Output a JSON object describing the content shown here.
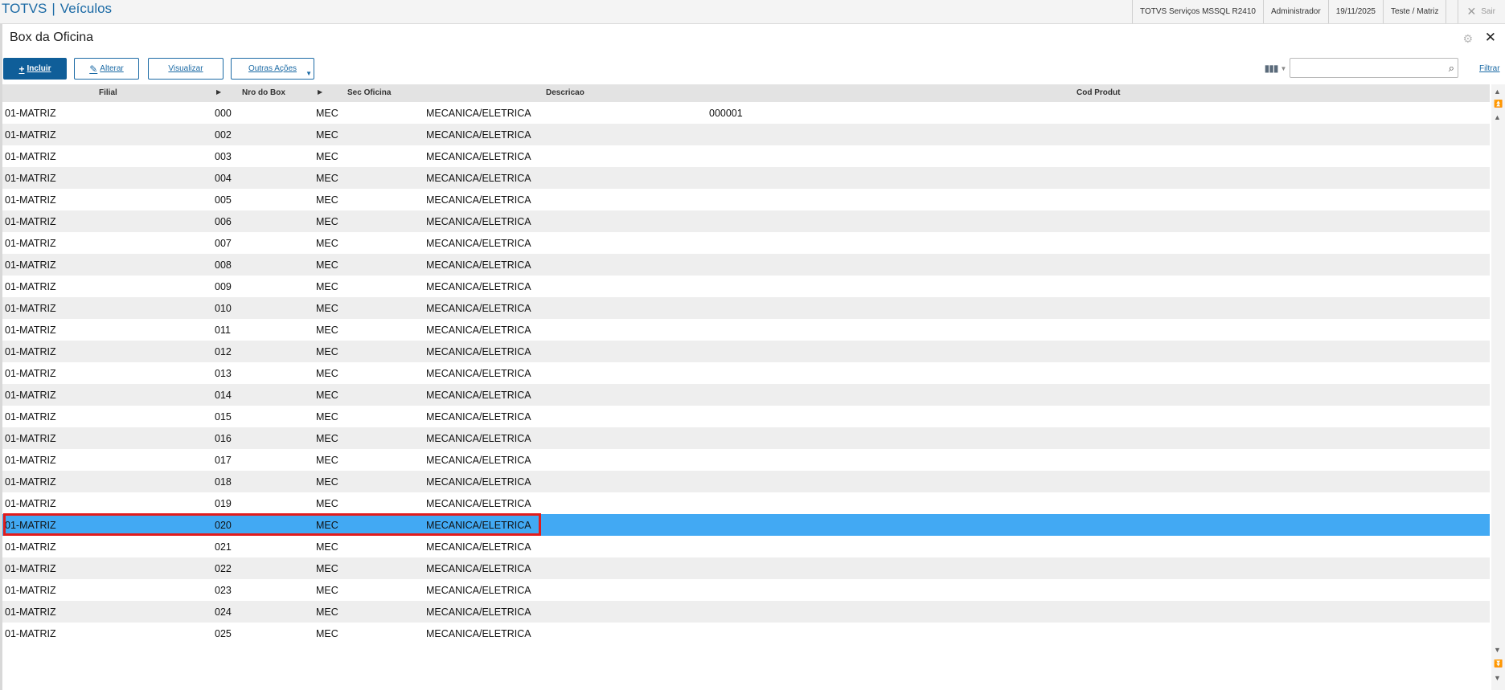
{
  "topbar": {
    "brand": "TOTVS",
    "module": "Veículos",
    "environment": "TOTVS Serviços MSSQL R2410",
    "user": "Administrador",
    "date": "19/11/2025",
    "company": "Teste / Matriz",
    "logout_label": "Sair"
  },
  "page": {
    "title": "Box da Oficina"
  },
  "toolbar": {
    "incluir": "Incluir",
    "alterar": "Alterar",
    "visualizar": "Visualizar",
    "outras_acoes": "Outras Ações",
    "filtrar": "Filtrar",
    "search_value": ""
  },
  "grid": {
    "columns": [
      "Filial",
      "Nro do Box",
      "Sec Oficina",
      "Descricao",
      "Cod Produt"
    ],
    "selected_index": 20,
    "rows": [
      [
        "01-MATRIZ",
        "000",
        "MEC",
        "MECANICA/ELETRICA",
        "000001"
      ],
      [
        "01-MATRIZ",
        "002",
        "MEC",
        "MECANICA/ELETRICA",
        ""
      ],
      [
        "01-MATRIZ",
        "003",
        "MEC",
        "MECANICA/ELETRICA",
        ""
      ],
      [
        "01-MATRIZ",
        "004",
        "MEC",
        "MECANICA/ELETRICA",
        ""
      ],
      [
        "01-MATRIZ",
        "005",
        "MEC",
        "MECANICA/ELETRICA",
        ""
      ],
      [
        "01-MATRIZ",
        "006",
        "MEC",
        "MECANICA/ELETRICA",
        ""
      ],
      [
        "01-MATRIZ",
        "007",
        "MEC",
        "MECANICA/ELETRICA",
        ""
      ],
      [
        "01-MATRIZ",
        "008",
        "MEC",
        "MECANICA/ELETRICA",
        ""
      ],
      [
        "01-MATRIZ",
        "009",
        "MEC",
        "MECANICA/ELETRICA",
        ""
      ],
      [
        "01-MATRIZ",
        "010",
        "MEC",
        "MECANICA/ELETRICA",
        ""
      ],
      [
        "01-MATRIZ",
        "011",
        "MEC",
        "MECANICA/ELETRICA",
        ""
      ],
      [
        "01-MATRIZ",
        "012",
        "MEC",
        "MECANICA/ELETRICA",
        ""
      ],
      [
        "01-MATRIZ",
        "013",
        "MEC",
        "MECANICA/ELETRICA",
        ""
      ],
      [
        "01-MATRIZ",
        "014",
        "MEC",
        "MECANICA/ELETRICA",
        ""
      ],
      [
        "01-MATRIZ",
        "015",
        "MEC",
        "MECANICA/ELETRICA",
        ""
      ],
      [
        "01-MATRIZ",
        "016",
        "MEC",
        "MECANICA/ELETRICA",
        ""
      ],
      [
        "01-MATRIZ",
        "017",
        "MEC",
        "MECANICA/ELETRICA",
        ""
      ],
      [
        "01-MATRIZ",
        "018",
        "MEC",
        "MECANICA/ELETRICA",
        ""
      ],
      [
        "01-MATRIZ",
        "019",
        "MEC",
        "MECANICA/ELETRICA",
        ""
      ],
      [
        "01-MATRIZ",
        "020",
        "MEC",
        "MECANICA/ELETRICA",
        ""
      ],
      [
        "01-MATRIZ",
        "021",
        "MEC",
        "MECANICA/ELETRICA",
        ""
      ],
      [
        "01-MATRIZ",
        "022",
        "MEC",
        "MECANICA/ELETRICA",
        ""
      ],
      [
        "01-MATRIZ",
        "023",
        "MEC",
        "MECANICA/ELETRICA",
        ""
      ],
      [
        "01-MATRIZ",
        "024",
        "MEC",
        "MECANICA/ELETRICA",
        ""
      ],
      [
        "01-MATRIZ",
        "025",
        "MEC",
        "MECANICA/ELETRICA",
        ""
      ]
    ]
  },
  "colors": {
    "brand_blue": "#1b6aa5",
    "primary_button": "#0f5e99",
    "selected_row": "#42a9f3",
    "highlight_outline": "#e21c1c"
  },
  "icons": {
    "close": "close-icon",
    "settings": "gear-icon",
    "search": "search-icon",
    "columns": "columns-icon"
  }
}
